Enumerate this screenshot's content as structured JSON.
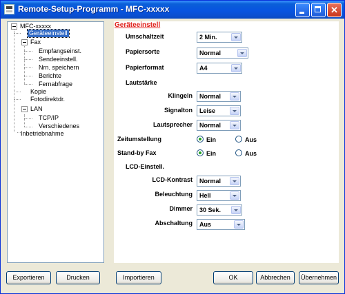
{
  "window": {
    "title": "Remote-Setup-Programm - MFC-xxxxx",
    "minimize_icon": "minimize-icon",
    "maximize_icon": "maximize-icon",
    "close_icon": "close-icon"
  },
  "tree": {
    "root": "MFC-xxxxx",
    "items": {
      "geraeteeinstell": "Geräteeinstell",
      "fax": "Fax",
      "empfangseinst": "Empfangseinst.",
      "sendeeinstell": "Sendeeinstell.",
      "nrn_speichern": "Nrn. speichern",
      "berichte": "Berichte",
      "fernabfrage": "Fernabfrage",
      "kopie": "Kopie",
      "fotodirektdr": "Fotodirektdr.",
      "lan": "LAN",
      "tcpip": "TCP/IP",
      "verschiedenes": "Verschiedenes",
      "inbetriebnahme": "Inbetriebnahme"
    },
    "selected": "Geräteeinstell"
  },
  "panel": {
    "title": "Geräteeinstell",
    "umschaltzeit": {
      "label": "Umschaltzeit",
      "value": "2 Min."
    },
    "papiersorte": {
      "label": "Papiersorte",
      "value": "Normal"
    },
    "papierformat": {
      "label": "Papierformat",
      "value": "A4"
    },
    "lautstaerke": "Lautstärke",
    "klingeln": {
      "label": "Klingeln",
      "value": "Normal"
    },
    "signalton": {
      "label": "Signalton",
      "value": "Leise"
    },
    "lautsprecher": {
      "label": "Lautsprecher",
      "value": "Normal"
    },
    "zeitumstellung": {
      "label": "Zeitumstellung",
      "on": "Ein",
      "off": "Aus",
      "selected": "Ein"
    },
    "standby_fax": {
      "label": "Stand-by Fax",
      "on": "Ein",
      "off": "Aus",
      "selected": "Ein"
    },
    "lcd_einstell": "LCD-Einstell.",
    "lcd_kontrast": {
      "label": "LCD-Kontrast",
      "value": "Normal"
    },
    "beleuchtung": {
      "label": "Beleuchtung",
      "value": "Hell"
    },
    "dimmer": {
      "label": "Dimmer",
      "value": "30 Sek."
    },
    "abschaltung": {
      "label": "Abschaltung",
      "value": "Aus"
    }
  },
  "buttons": {
    "exportieren": "Exportieren",
    "drucken": "Drucken",
    "importieren": "Importieren",
    "ok": "OK",
    "abbrechen": "Abbrechen",
    "uebernehmen": "Übernehmen"
  }
}
